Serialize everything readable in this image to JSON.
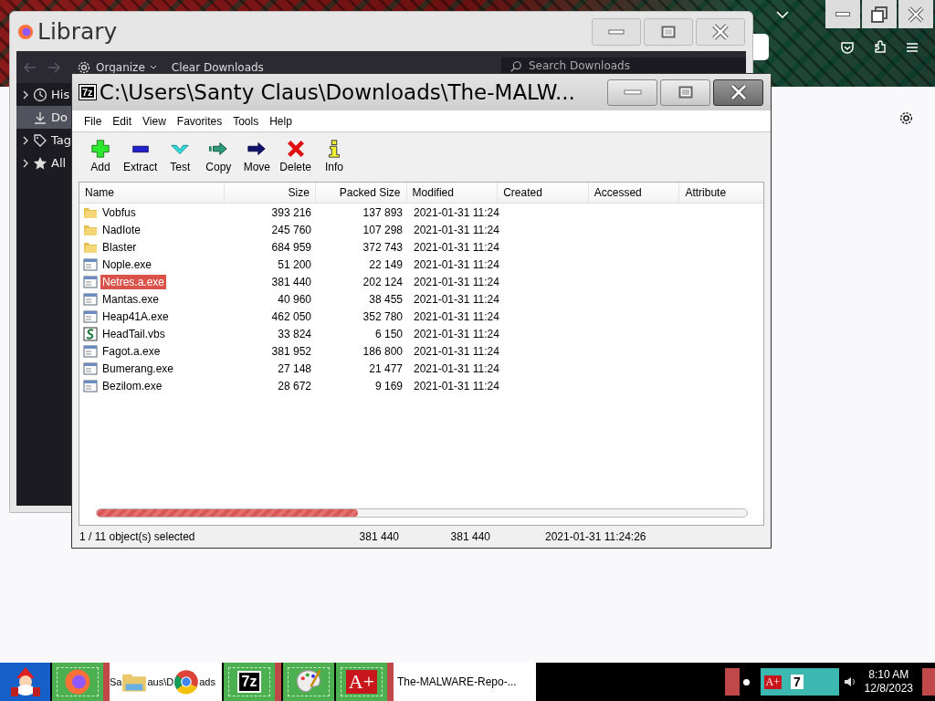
{
  "library_window": {
    "title": "Library",
    "organize": "Organize",
    "clear_downloads": "Clear Downloads",
    "search": {
      "placeholder": "Search Downloads"
    },
    "sidebar": [
      {
        "label": "His",
        "kind": "history",
        "expandable": true,
        "selected": false
      },
      {
        "label": "Do",
        "kind": "downloads",
        "expandable": false,
        "selected": true
      },
      {
        "label": "Tag",
        "kind": "tags",
        "expandable": true,
        "selected": false
      },
      {
        "label": "All",
        "kind": "all",
        "expandable": true,
        "selected": false
      }
    ]
  },
  "archive_window": {
    "app_icon": "7z",
    "title": "C:\\Users\\Santy Claus\\Downloads\\The-MALW...",
    "menu": [
      "File",
      "Edit",
      "View",
      "Favorites",
      "Tools",
      "Help"
    ],
    "toolbar": [
      {
        "label": "Add",
        "kind": "add"
      },
      {
        "label": "Extract",
        "kind": "extract"
      },
      {
        "label": "Test",
        "kind": "test"
      },
      {
        "label": "Copy",
        "kind": "copy"
      },
      {
        "label": "Move",
        "kind": "move"
      },
      {
        "label": "Delete",
        "kind": "delete"
      },
      {
        "label": "Info",
        "kind": "info"
      }
    ],
    "columns": [
      "Name",
      "Size",
      "Packed Size",
      "Modified",
      "Created",
      "Accessed",
      "Attribute"
    ],
    "rows": [
      {
        "name": "Vobfus",
        "kind": "folder",
        "size": "393 216",
        "packed_size": "137 893",
        "modified": "2021-01-31 11:24",
        "selected": false
      },
      {
        "name": "NadIote",
        "kind": "folder",
        "size": "245 760",
        "packed_size": "107 298",
        "modified": "2021-01-31 11:24",
        "selected": false
      },
      {
        "name": "Blaster",
        "kind": "folder",
        "size": "684 959",
        "packed_size": "372 743",
        "modified": "2021-01-31 11:24",
        "selected": false
      },
      {
        "name": "Nople.exe",
        "kind": "exe",
        "size": "51 200",
        "packed_size": "22 149",
        "modified": "2021-01-31 11:24",
        "selected": false
      },
      {
        "name": "Netres.a.exe",
        "kind": "exe",
        "size": "381 440",
        "packed_size": "202 124",
        "modified": "2021-01-31 11:24",
        "selected": true
      },
      {
        "name": "Mantas.exe",
        "kind": "exe",
        "size": "40 960",
        "packed_size": "38 455",
        "modified": "2021-01-31 11:24",
        "selected": false
      },
      {
        "name": "Heap41A.exe",
        "kind": "exe",
        "size": "462 050",
        "packed_size": "352 780",
        "modified": "2021-01-31 11:24",
        "selected": false
      },
      {
        "name": "HeadTail.vbs",
        "kind": "script",
        "size": "33 824",
        "packed_size": "6 150",
        "modified": "2021-01-31 11:24",
        "selected": false
      },
      {
        "name": "Fagot.a.exe",
        "kind": "exe",
        "size": "381 952",
        "packed_size": "186 800",
        "modified": "2021-01-31 11:24",
        "selected": false
      },
      {
        "name": "Bumerang.exe",
        "kind": "exe",
        "size": "27 148",
        "packed_size": "21 477",
        "modified": "2021-01-31 11:24",
        "selected": false
      },
      {
        "name": "Bezilom.exe",
        "kind": "exe",
        "size": "28 672",
        "packed_size": "9 169",
        "modified": "2021-01-31 11:24",
        "selected": false
      }
    ],
    "status_bar": {
      "selection": "1 / 11 object(s) selected",
      "size": "381 440",
      "packed_size": "381 440",
      "modified": "2021-01-31 11:24:26"
    }
  },
  "taskbar": {
    "explorer_label_parts": [
      "Sa",
      "aus\\D",
      "ads"
    ],
    "sevenzip_glyph": "7z",
    "reader_glyph": "A+",
    "window_label": "The-MALWARE-Repo-...",
    "tray_glyphs": [
      "A+",
      "7"
    ],
    "clock": {
      "time": "8:10 AM",
      "date": "12/8/2023"
    }
  }
}
